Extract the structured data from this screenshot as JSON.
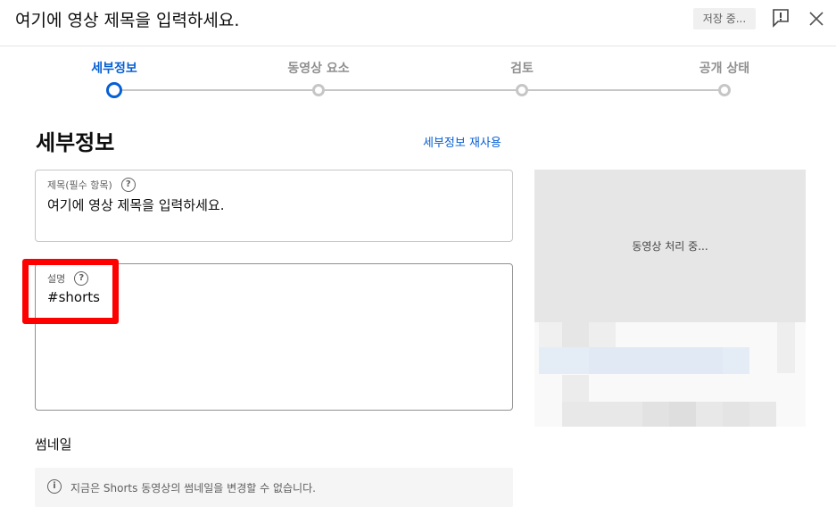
{
  "header": {
    "title": "여기에 영상 제목을 입력하세요.",
    "saving_status": "저장 중...",
    "feedback_icon": "feedback-flag-icon",
    "close_icon": "close-icon"
  },
  "stepper": {
    "steps": [
      {
        "label": "세부정보",
        "state": "active"
      },
      {
        "label": "동영상 요소",
        "state": "inactive"
      },
      {
        "label": "검토",
        "state": "inactive"
      },
      {
        "label": "공개 상태",
        "state": "inactive"
      }
    ],
    "colors": {
      "active": "#065fd4",
      "inactive": "#c6c6c6"
    }
  },
  "details": {
    "section_title": "세부정보",
    "reuse_link": "세부정보 재사용",
    "title_field": {
      "label": "제목(필수 항목)",
      "value": "여기에 영상 제목을 입력하세요.",
      "help_icon": "?"
    },
    "description_field": {
      "label": "설명",
      "value": "#shorts",
      "help_icon": "?"
    },
    "annotation_color": "#ff0000"
  },
  "thumbnail": {
    "title": "썸네일",
    "info_icon": "i",
    "info_text": "지금은 Shorts 동영상의 썸네일을 변경할 수 없습니다."
  },
  "preview": {
    "status": "동영상 처리 중..."
  }
}
